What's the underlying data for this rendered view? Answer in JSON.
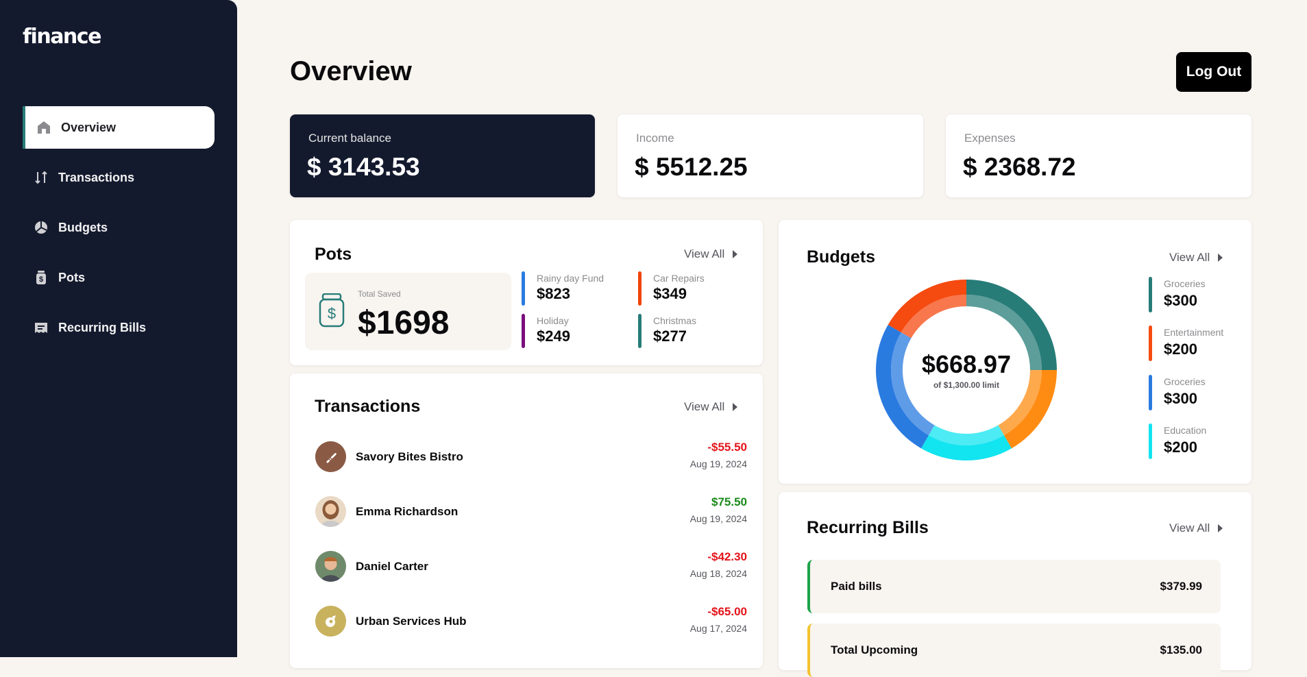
{
  "app": {
    "logo": "finance"
  },
  "nav": {
    "items": [
      {
        "label": "Overview",
        "icon": "home-icon",
        "active": true
      },
      {
        "label": "Transactions",
        "icon": "arrows-up-down-icon"
      },
      {
        "label": "Budgets",
        "icon": "pie-chart-icon"
      },
      {
        "label": "Pots",
        "icon": "jar-icon"
      },
      {
        "label": "Recurring Bills",
        "icon": "receipt-icon"
      }
    ]
  },
  "header": {
    "title": "Overview",
    "logout_label": "Log Out"
  },
  "stats": {
    "balance": {
      "label": "Current balance",
      "value": "$ 3143.53"
    },
    "income": {
      "label": "Income",
      "value": "$ 5512.25"
    },
    "expenses": {
      "label": "Expenses",
      "value": "$ 2368.72"
    }
  },
  "pots": {
    "title": "Pots",
    "view_all": "View All",
    "total_label": "Total Saved",
    "total_value": "$1698",
    "items": [
      {
        "name": "Rainy day Fund",
        "value": "$823",
        "color": "#2a7be0"
      },
      {
        "name": "Car Repairs",
        "value": "$349",
        "color": "#f0440a"
      },
      {
        "name": "Holiday",
        "value": "$249",
        "color": "#7a0f7a"
      },
      {
        "name": "Christmas",
        "value": "$277",
        "color": "#277c78"
      }
    ]
  },
  "transactions": {
    "title": "Transactions",
    "view_all": "View All",
    "items": [
      {
        "name": "Savory Bites Bistro",
        "amount": "-$55.50",
        "date": "Aug 19, 2024",
        "type": "debit",
        "avatar_color": "#8a5a45"
      },
      {
        "name": "Emma Richardson",
        "amount": "$75.50",
        "date": "Aug 19, 2024",
        "type": "credit",
        "avatar_color": "#c9a27a"
      },
      {
        "name": "Daniel Carter",
        "amount": "-$42.30",
        "date": "Aug 18, 2024",
        "type": "debit",
        "avatar_color": "#6f8a6a"
      },
      {
        "name": "Urban Services Hub",
        "amount": "-$65.00",
        "date": "Aug 17, 2024",
        "type": "debit",
        "avatar_color": "#c8b25e"
      }
    ],
    "colors": {
      "debit": "#e3141a",
      "credit": "#1a8a1a"
    }
  },
  "budgets": {
    "title": "Budgets",
    "view_all": "View All",
    "spent": "$668.97",
    "limit_text": "of $1,300.00 limit",
    "legend": [
      {
        "name": "Groceries",
        "value": "$300",
        "color": "#277c78"
      },
      {
        "name": "Entertainment",
        "value": "$200",
        "color": "#f54a10"
      },
      {
        "name": "Groceries",
        "value": "$300",
        "color": "#2a7be0"
      },
      {
        "name": "Education",
        "value": "$200",
        "color": "#12e4f0"
      }
    ],
    "segments": [
      {
        "name": "Groceries",
        "value": 300,
        "color": "#277c78"
      },
      {
        "name": "Orange",
        "value": 200,
        "color": "#ff8c12"
      },
      {
        "name": "Education",
        "value": 200,
        "color": "#12e4f0"
      },
      {
        "name": "Blue",
        "value": 300,
        "color": "#2a7be0"
      },
      {
        "name": "Entertainment",
        "value": 200,
        "color": "#f54a10"
      }
    ]
  },
  "bills": {
    "title": "Recurring Bills",
    "view_all": "View All",
    "items": [
      {
        "name": "Paid bills",
        "value": "$379.99",
        "color": "#1ea34a"
      },
      {
        "name": "Total Upcoming",
        "value": "$135.00",
        "color": "#f2c22e"
      }
    ]
  }
}
